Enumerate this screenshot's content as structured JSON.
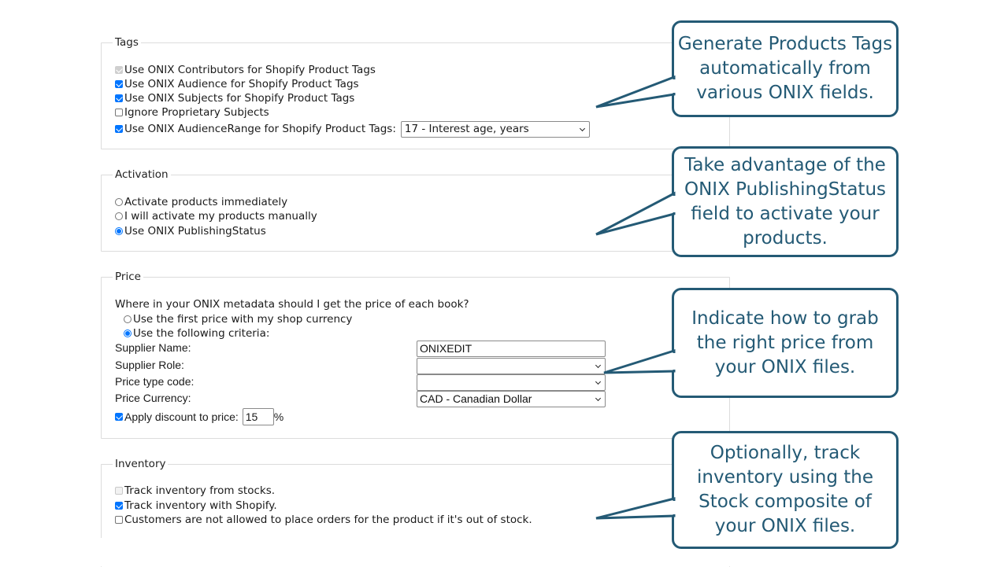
{
  "tags": {
    "legend": "Tags",
    "options": [
      {
        "label": "Use ONIX Contributors for Shopify Product Tags",
        "checked": true,
        "disabled": true
      },
      {
        "label": "Use ONIX Audience for Shopify Product Tags",
        "checked": true,
        "disabled": false
      },
      {
        "label": "Use ONIX Subjects for Shopify Product Tags",
        "checked": true,
        "disabled": false
      },
      {
        "label": "Ignore Proprietary Subjects",
        "checked": false,
        "disabled": false
      },
      {
        "label": "Use ONIX AudienceRange for Shopify Product Tags:",
        "checked": true,
        "disabled": false
      }
    ],
    "audience_range_select": "17 - Interest age, years"
  },
  "activation": {
    "legend": "Activation",
    "options": [
      {
        "label": "Activate products immediately",
        "selected": false
      },
      {
        "label": "I will activate my products manually",
        "selected": false
      },
      {
        "label": "Use ONIX PublishingStatus",
        "selected": true
      }
    ]
  },
  "price": {
    "legend": "Price",
    "question": "Where in your ONIX metadata should I get the price of each book?",
    "options": [
      {
        "label": "Use the first price with my shop currency",
        "selected": false
      },
      {
        "label": "Use the following criteria:",
        "selected": true
      }
    ],
    "fields": {
      "supplier_name_label": "Supplier Name:",
      "supplier_name_value": "ONIXEDIT",
      "supplier_role_label": "Supplier Role:",
      "supplier_role_value": "",
      "price_type_label": "Price type code:",
      "price_type_value": "",
      "currency_label": "Price Currency:",
      "currency_value": "CAD - Canadian Dollar"
    },
    "discount": {
      "label": "Apply discount to price:",
      "checked": true,
      "value": "15",
      "unit": "%"
    }
  },
  "inventory": {
    "legend": "Inventory",
    "options": [
      {
        "label": "Track inventory from stocks.",
        "checked": false,
        "disabled": true
      },
      {
        "label": "Track inventory with Shopify.",
        "checked": true,
        "disabled": false
      },
      {
        "label": "Customers are not allowed to place orders for the product if it's out of stock.",
        "checked": false,
        "disabled": false
      }
    ]
  },
  "callouts": [
    {
      "text": "Generate Products Tags automatically from various ONIX fields."
    },
    {
      "text": "Take advantage of the ONIX PublishingStatus field to activate your products."
    },
    {
      "text": "Indicate how to grab the right price from your ONIX files."
    },
    {
      "text": "Optionally, track inventory using the Stock composite of your ONIX files."
    }
  ],
  "colors": {
    "accent": "#0075ff",
    "callout": "#245a75"
  }
}
